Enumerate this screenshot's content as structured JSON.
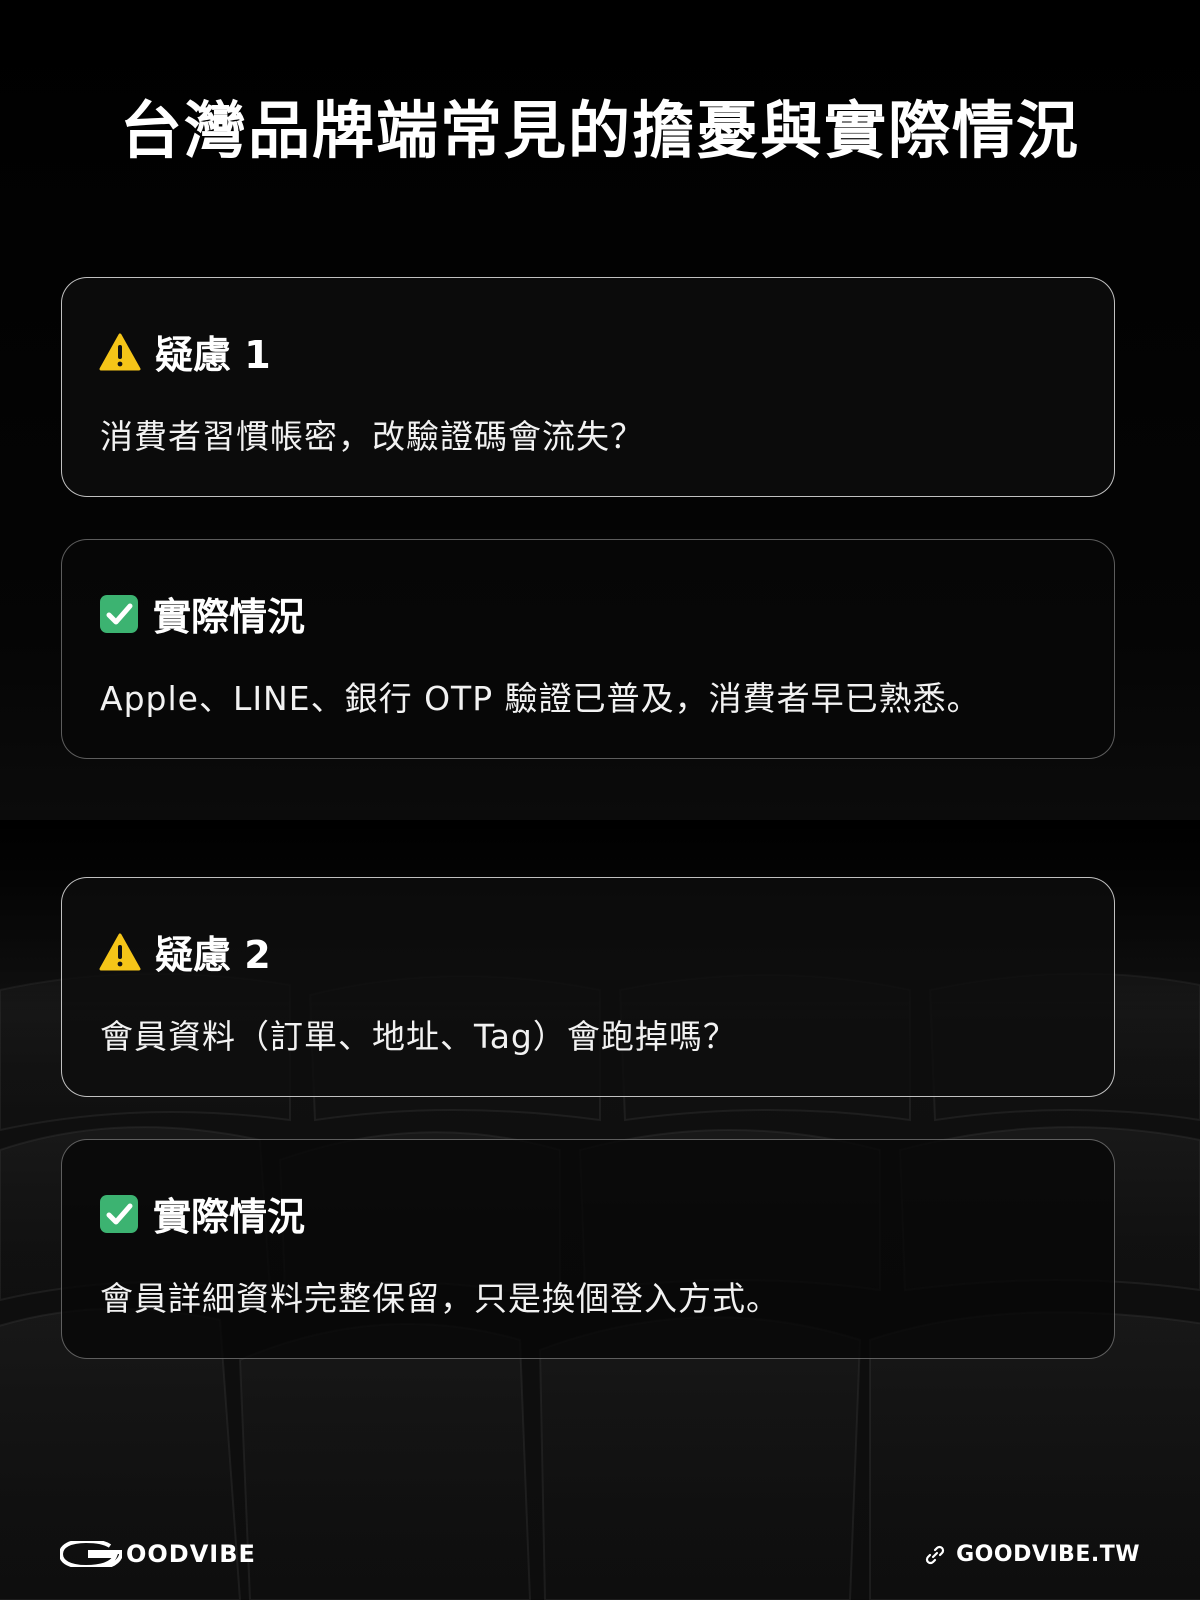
{
  "title": "台灣品牌端常見的擔憂與實際情況",
  "cards": [
    {
      "type": "concern",
      "icon": "warning-icon",
      "heading": "疑慮 1",
      "body": "消費者習慣帳密，改驗證碼會流失？"
    },
    {
      "type": "solution",
      "icon": "check-icon",
      "heading": "實際情況",
      "body": "Apple、LINE、銀行 OTP 驗證已普及，消費者早已熟悉。"
    },
    {
      "type": "concern",
      "icon": "warning-icon",
      "heading": "疑慮 2",
      "body": "會員資料（訂單、地址、Tag）會跑掉嗎？"
    },
    {
      "type": "solution",
      "icon": "check-icon",
      "heading": "實際情況",
      "body": "會員詳細資料完整保留，只是換個登入方式。"
    }
  ],
  "footer": {
    "logo_text": "OODVIBE",
    "site": "GOODVIBE.TW",
    "link_icon": "link-icon"
  },
  "colors": {
    "warning": "#F5C518",
    "check": "#3CB371",
    "text": "#FFFFFF"
  }
}
